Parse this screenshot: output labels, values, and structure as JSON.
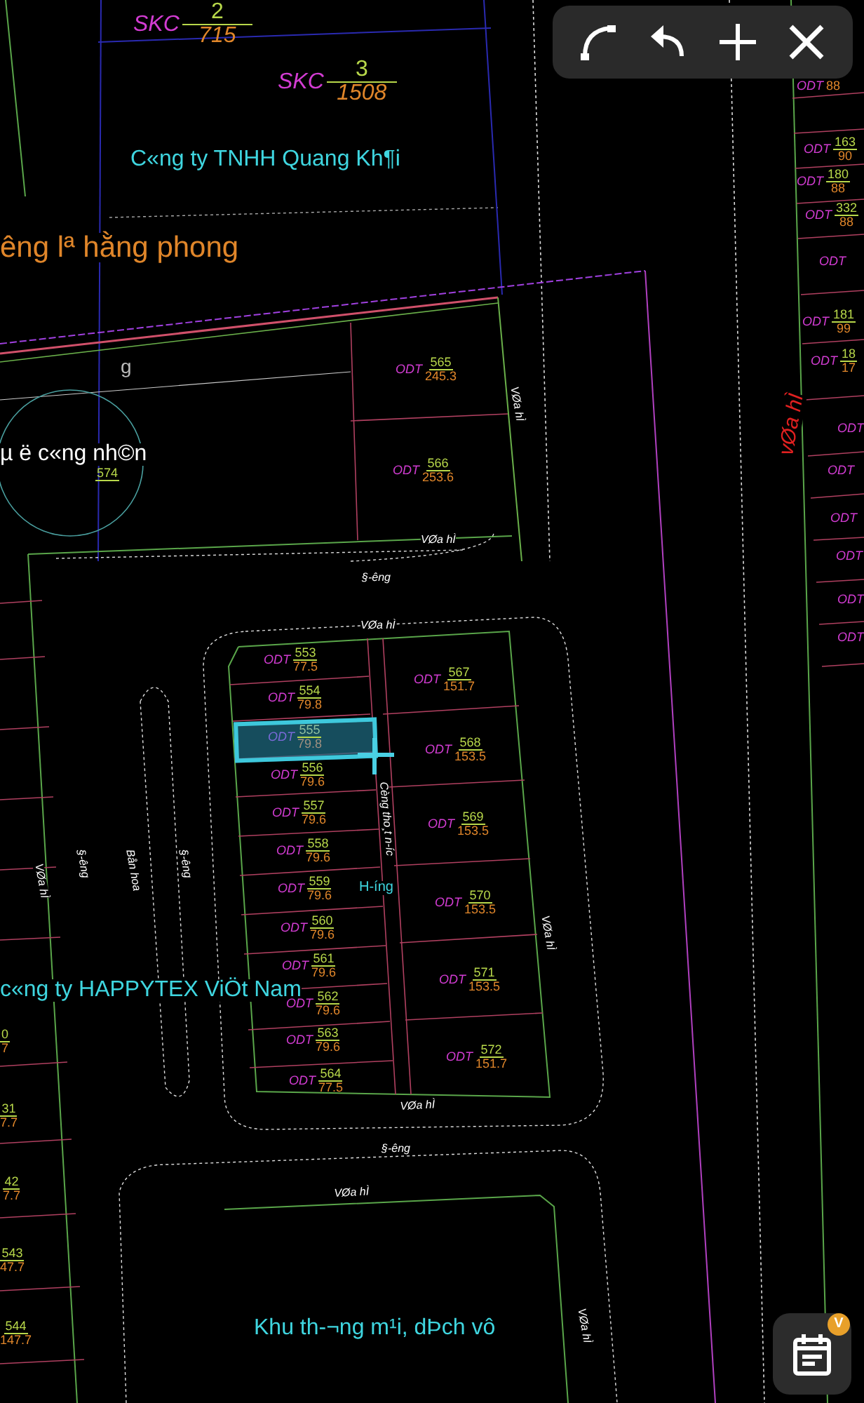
{
  "toolbar": {
    "buttons": [
      {
        "kind": "curve"
      },
      {
        "kind": "undo"
      },
      {
        "kind": "add"
      },
      {
        "kind": "close"
      }
    ]
  },
  "map": {
    "area_labels": [
      {
        "kind": "company",
        "text": "C«ng ty TNHH Quang Kh¶i"
      },
      {
        "kind": "district",
        "text": "êng lª hằng phong"
      },
      {
        "kind": "housing",
        "text": "µ ë c«ng nh©n"
      },
      {
        "kind": "company",
        "text": "c«ng ty HAPPYTEX ViÖt Nam"
      },
      {
        "kind": "company",
        "text": "Khu th-¬ng m¹i, dÞch vô"
      }
    ],
    "road_labels": [
      {
        "kind": "minor",
        "text": "VØa hÌ"
      },
      {
        "kind": "minor",
        "text": "VØa hÌ"
      },
      {
        "kind": "minor",
        "text": "§-êng"
      },
      {
        "kind": "minor",
        "text": "VØa hÌ"
      },
      {
        "kind": "minor",
        "text": "VØa hÌ"
      },
      {
        "kind": "minor",
        "text": "§-êng"
      },
      {
        "kind": "minor",
        "text": "Bån hoa"
      },
      {
        "kind": "minor",
        "text": "§-êng"
      },
      {
        "kind": "minor",
        "text": "VØa hÌ"
      },
      {
        "kind": "minor",
        "text": "VØa hÌ"
      },
      {
        "kind": "minor",
        "text": "§-êng"
      },
      {
        "kind": "minor",
        "text": "VØa hÌ"
      },
      {
        "kind": "minor",
        "text": "VØa hÌ"
      },
      {
        "kind": "major",
        "text": "vØa hÌ"
      },
      {
        "kind": "note",
        "text": "Cèng tho¸t n-íc"
      },
      {
        "kind": "direction",
        "text": "H-íng"
      },
      {
        "kind": "minor",
        "text": "g"
      }
    ],
    "block_parcels": [
      {
        "use": "ODT",
        "number": "553",
        "area": "77.5",
        "selected": false
      },
      {
        "use": "ODT",
        "number": "554",
        "area": "79.8",
        "selected": false
      },
      {
        "use": "ODT",
        "number": "555",
        "area": "79.8",
        "selected": true
      },
      {
        "use": "ODT",
        "number": "556",
        "area": "79.6",
        "selected": false
      },
      {
        "use": "ODT",
        "number": "557",
        "area": "79.6",
        "selected": false
      },
      {
        "use": "ODT",
        "number": "558",
        "area": "79.6",
        "selected": false
      },
      {
        "use": "ODT",
        "number": "559",
        "area": "79.6",
        "selected": false
      },
      {
        "use": "ODT",
        "number": "560",
        "area": "79.6",
        "selected": false
      },
      {
        "use": "ODT",
        "number": "561",
        "area": "79.6",
        "selected": false
      },
      {
        "use": "ODT",
        "number": "562",
        "area": "79.6",
        "selected": false
      },
      {
        "use": "ODT",
        "number": "563",
        "area": "79.6",
        "selected": false
      },
      {
        "use": "ODT",
        "number": "564",
        "area": "77.5",
        "selected": false
      },
      {
        "use": "ODT",
        "number": "567",
        "area": "151.7",
        "selected": false
      },
      {
        "use": "ODT",
        "number": "568",
        "area": "153.5",
        "selected": false
      },
      {
        "use": "ODT",
        "number": "569",
        "area": "153.5",
        "selected": false
      },
      {
        "use": "ODT",
        "number": "570",
        "area": "153.5",
        "selected": false
      },
      {
        "use": "ODT",
        "number": "571",
        "area": "153.5",
        "selected": false
      },
      {
        "use": "ODT",
        "number": "572",
        "area": "151.7",
        "selected": false
      }
    ],
    "other_parcels": [
      {
        "use": "SKC",
        "number": "2",
        "area": "715"
      },
      {
        "use": "SKC",
        "number": "3",
        "area": "1508"
      },
      {
        "use": "ODT",
        "number": "565",
        "area": "245.3"
      },
      {
        "number": "574"
      },
      {
        "use": "ODT",
        "number": "566",
        "area": "253.6"
      },
      {
        "use": "ODT",
        "area": "88"
      },
      {
        "use": "ODT",
        "number": "163",
        "area": "90"
      },
      {
        "use": "ODT",
        "number": "180",
        "area": "88"
      },
      {
        "use": "ODT",
        "number": "332",
        "area": "88"
      },
      {
        "use": "ODT"
      },
      {
        "use": "ODT",
        "number": "181",
        "area": "99"
      },
      {
        "use": "ODT",
        "number": "18",
        "area": "17"
      },
      {
        "use": "ODT"
      },
      {
        "use": "ODT"
      },
      {
        "use": "ODT"
      },
      {
        "use": "ODT"
      },
      {
        "use": "ODT"
      },
      {
        "use": "ODT"
      },
      {
        "number": "0",
        "area": "7"
      },
      {
        "number": "31",
        "area": "7.7"
      },
      {
        "number": "42",
        "area": "7.7"
      },
      {
        "number": "543",
        "area": "47.7"
      },
      {
        "number": "544",
        "area": "147.7"
      }
    ]
  },
  "calendar_button": {
    "badge": "V"
  }
}
